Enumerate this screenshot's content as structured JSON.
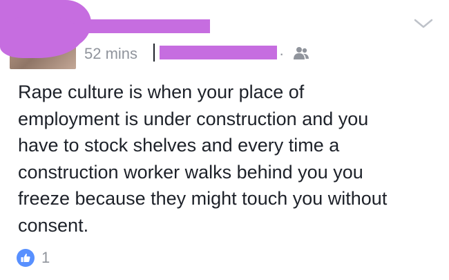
{
  "post": {
    "timestamp": "52 mins",
    "meta_separator": "·",
    "audience_icon": "friends-icon",
    "menu_icon": "chevron-down-icon",
    "body_text": "Rape culture is when your place of\nemployment is under construction and you\nhave to stock shelves and every time a\nconstruction worker walks behind you you\nfreeze because they might touch you without\nconsent.",
    "reactions": {
      "icon": "like-icon",
      "count": "1"
    }
  },
  "colors": {
    "redaction": "#c66de0",
    "like_blue": "#5890ff",
    "meta_gray": "#90949c",
    "text": "#1d2129"
  }
}
